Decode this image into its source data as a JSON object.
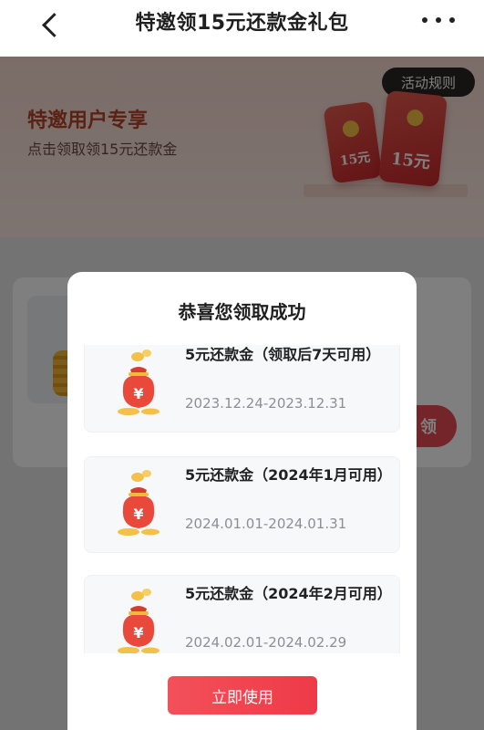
{
  "nav": {
    "title": "特邀领15元还款金礼包"
  },
  "banner": {
    "title": "特邀用户专享",
    "subtitle": "点击领取领15元还款金",
    "rules_label": "活动规则",
    "envelope_small_label": "15元",
    "envelope_large_label": "15元"
  },
  "background_card": {
    "claim_label": "领"
  },
  "modal": {
    "title": "恭喜您领取成功",
    "coupons": [
      {
        "name": "5元还款金（领取后7天可用）",
        "date": "2023.12.24-2023.12.31"
      },
      {
        "name": "5元还款金（2024年1月可用）",
        "date": "2024.01.01-2024.01.31"
      },
      {
        "name": "5元还款金（2024年2月可用）",
        "date": "2024.02.01-2024.02.29"
      }
    ],
    "use_button_label": "立即使用"
  },
  "colors": {
    "accent": "#ee3a48",
    "banner_text": "#b4432b",
    "overlay": "rgba(0,0,0,0.5)"
  },
  "icons": [
    "back-icon",
    "more-icon",
    "money-bag-icon"
  ]
}
